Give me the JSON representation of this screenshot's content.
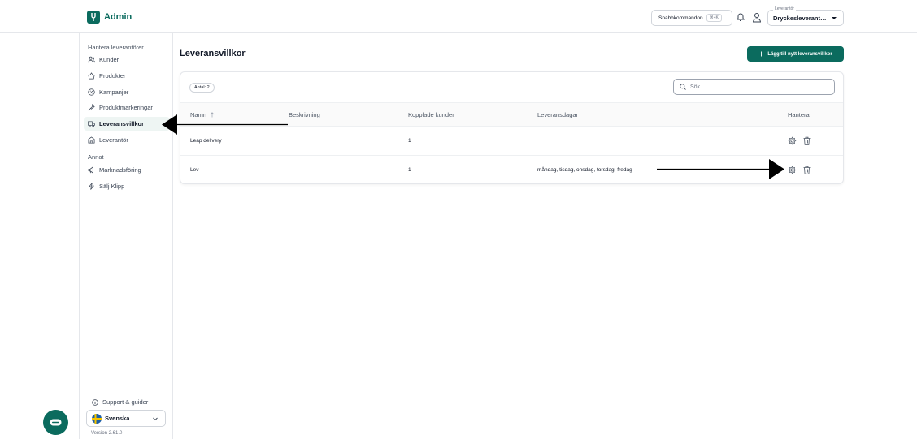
{
  "app": {
    "name": "Admin",
    "brand_color": "#0b6b5e"
  },
  "header": {
    "command_label": "Snabbkommandon",
    "command_shortcut": "⌘+K",
    "supplier_legend": "Leverantör",
    "supplier_value": "Dryckesleverant…"
  },
  "sidebar": {
    "groups": [
      {
        "title": "Hantera leverantörer",
        "items": [
          {
            "label": "Kunder",
            "icon": "users-icon"
          },
          {
            "label": "Produkter",
            "icon": "basket-icon"
          },
          {
            "label": "Kampanjer",
            "icon": "percent-icon"
          },
          {
            "label": "Produktmarkeringar",
            "icon": "pin-icon"
          },
          {
            "label": "Leveransvillkor",
            "icon": "truck-icon",
            "active": true
          },
          {
            "label": "Leverantör",
            "icon": "building-icon"
          }
        ]
      },
      {
        "title": "Annat",
        "items": [
          {
            "label": "Marknadsföring",
            "icon": "megaphone-icon"
          },
          {
            "label": "Sälj Klipp",
            "icon": "bolt-icon"
          }
        ]
      }
    ],
    "support_label": "Support & guider",
    "language": "Svenska",
    "version": "Version 2.61.0"
  },
  "main": {
    "title": "Leveransvillkor",
    "add_button": "Lägg till nytt leveransvillkor",
    "count_badge": "Antal: 2",
    "search_placeholder": "Sök",
    "columns": {
      "name": "Namn",
      "description": "Beskrivning",
      "customers": "Kopplade kunder",
      "days": "Leveransdagar",
      "manage": "Hantera"
    },
    "rows": [
      {
        "name": "Leap delivery",
        "description": "",
        "customers": "1",
        "days": ""
      },
      {
        "name": "Lev",
        "description": "",
        "customers": "1",
        "days": "måndag, tisdag, onsdag, torsdag, fredag"
      }
    ]
  }
}
